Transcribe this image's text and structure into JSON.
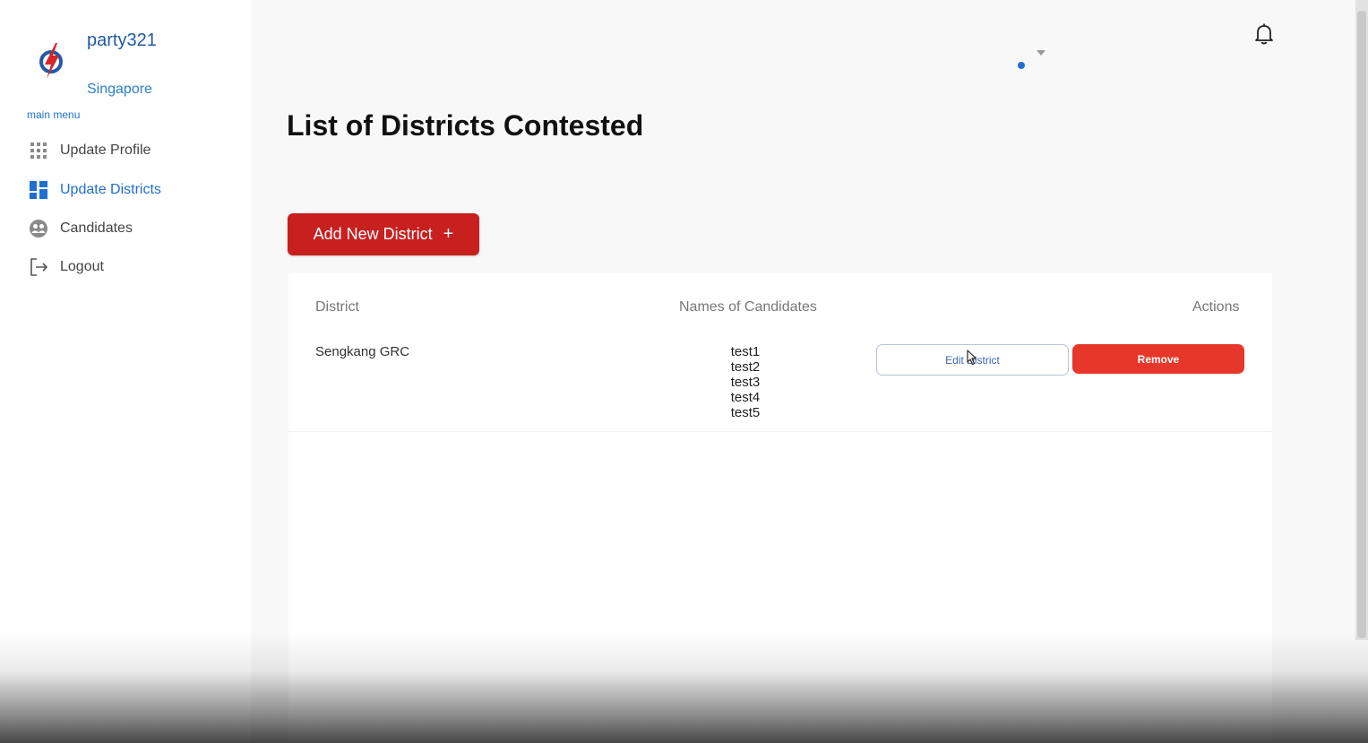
{
  "sidebar": {
    "party_name": "party321",
    "country": "Singapore",
    "menu_label": "main menu",
    "items": [
      {
        "label": "Update Profile",
        "icon": "grid-icon",
        "active": false
      },
      {
        "label": "Update Districts",
        "icon": "dashboard-icon",
        "active": true
      },
      {
        "label": "Candidates",
        "icon": "people-icon",
        "active": false
      },
      {
        "label": "Logout",
        "icon": "logout-icon",
        "active": false
      }
    ]
  },
  "main": {
    "title": "List of Districts Contested",
    "add_button_label": "Add New District",
    "add_button_icon": "+",
    "table": {
      "headers": [
        "District",
        "Names of Candidates",
        "Actions"
      ],
      "rows": [
        {
          "district": "Sengkang GRC",
          "candidates": [
            "test1",
            "test2",
            "test3",
            "test4",
            "test5"
          ],
          "edit_label": "Edit District",
          "remove_label": "Remove"
        }
      ]
    }
  },
  "colors": {
    "accent_blue": "#1f6fd1",
    "primary_red": "#c81f1f",
    "remove_red": "#e7372a"
  }
}
